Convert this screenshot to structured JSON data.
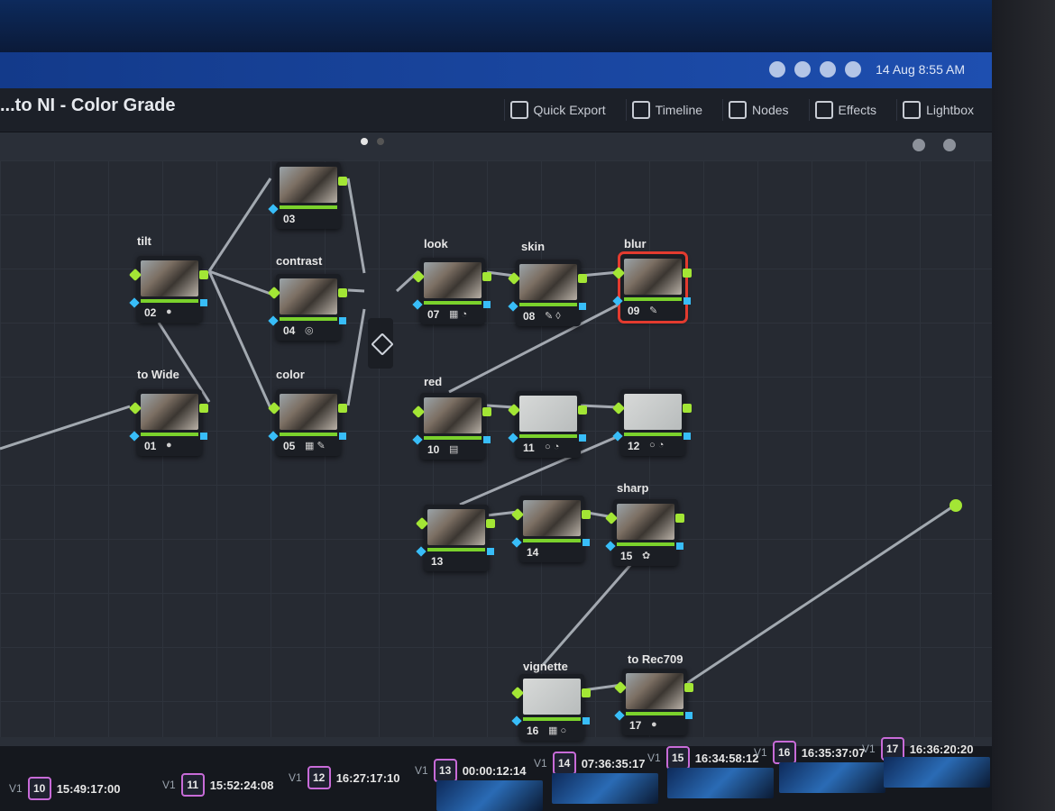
{
  "window": {
    "title": "...to NI - Color Grade"
  },
  "system_tray": {
    "clock": "14 Aug 8:55 AM",
    "icons": [
      "wifi-icon",
      "search-icon",
      "battery-icon",
      "control-center-icon"
    ]
  },
  "toolbar": {
    "quick_export": "Quick Export",
    "timeline": "Timeline",
    "nodes": "Nodes",
    "effects": "Effects",
    "lightbox": "Lightbox"
  },
  "node_labels": {
    "n02": "tilt",
    "n04": "contrast",
    "n05": "color",
    "n01": "to Wide",
    "n07": "look",
    "n08": "skin",
    "n09": "blur",
    "n10": "red",
    "n15": "sharp",
    "n16": "vignette",
    "n17": "to Rec709"
  },
  "nodes": {
    "n01": "01",
    "n02": "02",
    "n03": "03",
    "n04": "04",
    "n05": "05",
    "n07": "07",
    "n08": "08",
    "n09": "09",
    "n10": "10",
    "n11": "11",
    "n12": "12",
    "n13": "13",
    "n14": "14",
    "n15": "15",
    "n16": "16",
    "n17": "17"
  },
  "selected_node": "09",
  "timeline": {
    "clips": [
      {
        "track": "V1",
        "index": "10",
        "timecode": "15:49:17:00"
      },
      {
        "track": "V1",
        "index": "11",
        "timecode": "15:52:24:08"
      },
      {
        "track": "V1",
        "index": "12",
        "timecode": "16:27:17:10"
      },
      {
        "track": "V1",
        "index": "13",
        "timecode": "00:00:12:14"
      },
      {
        "track": "V1",
        "index": "14",
        "timecode": "07:36:35:17"
      },
      {
        "track": "V1",
        "index": "15",
        "timecode": "16:34:58:12"
      },
      {
        "track": "V1",
        "index": "16",
        "timecode": "16:35:37:07"
      },
      {
        "track": "V1",
        "index": "17",
        "timecode": "16:36:20:20"
      }
    ]
  },
  "colors": {
    "selection": "#e33b2f",
    "rgb_output": "#a3e635",
    "alpha_output": "#38bdf8",
    "accent_blue": "#1e4fb0"
  }
}
